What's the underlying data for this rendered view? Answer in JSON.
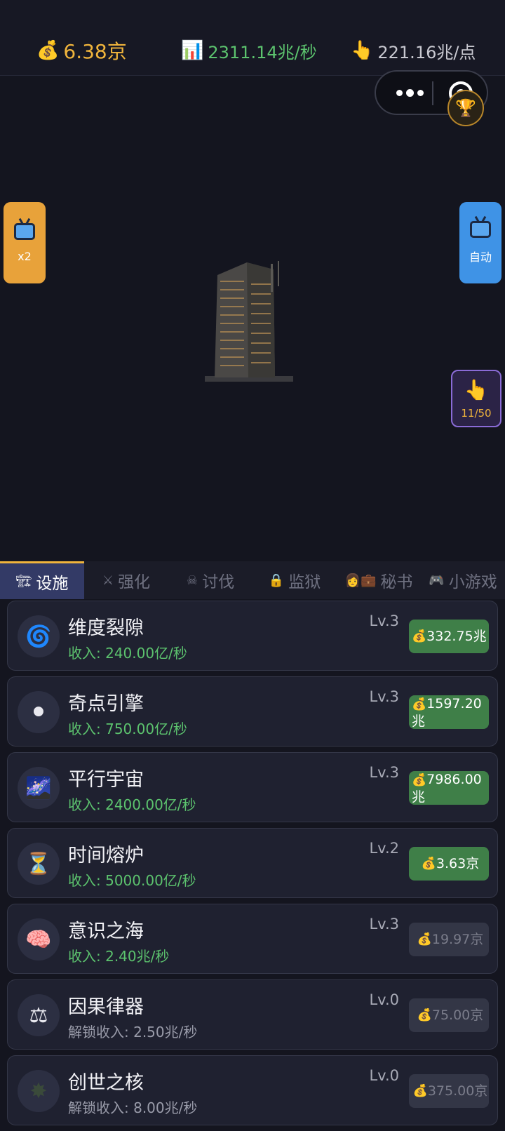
{
  "top_stats": {
    "money": "6.38京",
    "rate": "2311.14兆/秒",
    "click": "221.16兆/点"
  },
  "side_buttons": {
    "double": "x2",
    "auto": "自动",
    "taps": "11/50"
  },
  "tabs": [
    {
      "label": "设施",
      "icon": "facility-icon"
    },
    {
      "label": "强化",
      "icon": "swords-icon"
    },
    {
      "label": "讨伐",
      "icon": "monster-icon"
    },
    {
      "label": "监狱",
      "icon": "lock-icon"
    },
    {
      "label": "秘书",
      "icon": "secretary-icon"
    },
    {
      "label": "小游戏",
      "icon": "gamepad-icon"
    }
  ],
  "facilities": [
    {
      "name": "维度裂隙",
      "level": "Lv.3",
      "income": "收入: 240.00亿/秒",
      "price": "332.75兆",
      "icon": "vortex-icon",
      "affordable": true
    },
    {
      "name": "奇点引擎",
      "level": "Lv.3",
      "income": "收入: 750.00亿/秒",
      "price": "1597.20兆",
      "icon": "black-hole-icon",
      "affordable": true
    },
    {
      "name": "平行宇宙",
      "level": "Lv.3",
      "income": "收入: 2400.00亿/秒",
      "price": "7986.00兆",
      "icon": "milky-way-icon",
      "affordable": true
    },
    {
      "name": "时间熔炉",
      "level": "Lv.2",
      "income": "收入: 5000.00亿/秒",
      "price": "3.63京",
      "icon": "hourglass-icon",
      "affordable": true
    },
    {
      "name": "意识之海",
      "level": "Lv.3",
      "income": "收入: 2.40兆/秒",
      "price": "19.97京",
      "icon": "brain-icon",
      "affordable": false
    },
    {
      "name": "因果律器",
      "level": "Lv.0",
      "income": "解锁收入: 2.50兆/秒",
      "price": "75.00京",
      "icon": "scales-icon",
      "affordable": false
    },
    {
      "name": "创世之核",
      "level": "Lv.0",
      "income": "解锁收入: 8.00兆/秒",
      "price": "375.00京",
      "icon": "core-icon",
      "affordable": false
    }
  ],
  "colors": {
    "gold": "#f0b43c",
    "green": "#5cc36e",
    "buy_active": "#3f7f48",
    "tab_active": "#333a66"
  }
}
